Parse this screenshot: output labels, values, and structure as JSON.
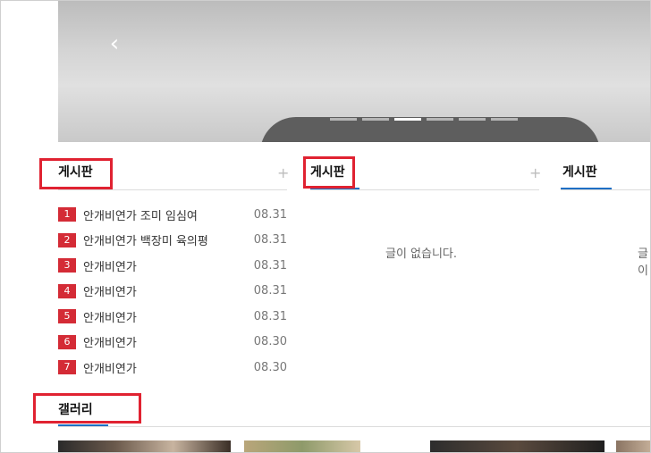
{
  "hero": {
    "prev_icon": "chevron-left-icon",
    "slides": [
      {
        "active": false
      },
      {
        "active": false
      },
      {
        "active": true
      },
      {
        "active": false
      },
      {
        "active": false
      },
      {
        "active": false
      }
    ]
  },
  "boards": [
    {
      "title": "게시판",
      "more": "+",
      "posts": [
        {
          "num": "1",
          "title": "안개비연가 조미 임심여",
          "date": "08.31"
        },
        {
          "num": "2",
          "title": "안개비연가 백장미 육의평",
          "date": "08.31"
        },
        {
          "num": "3",
          "title": "안개비연가",
          "date": "08.31"
        },
        {
          "num": "4",
          "title": "안개비연가",
          "date": "08.31"
        },
        {
          "num": "5",
          "title": "안개비연가",
          "date": "08.31"
        },
        {
          "num": "6",
          "title": "안개비연가",
          "date": "08.30"
        },
        {
          "num": "7",
          "title": "안개비연가",
          "date": "08.30"
        }
      ]
    },
    {
      "title": "게시판",
      "more": "+",
      "empty_text": "글이 없습니다."
    },
    {
      "title": "게시판",
      "empty_text": "글이"
    }
  ],
  "gallery": {
    "title": "갤러리"
  },
  "colors": {
    "accent": "#1e6fc4",
    "highlight_box": "#e02231",
    "rank_badge": "#d42b36"
  }
}
